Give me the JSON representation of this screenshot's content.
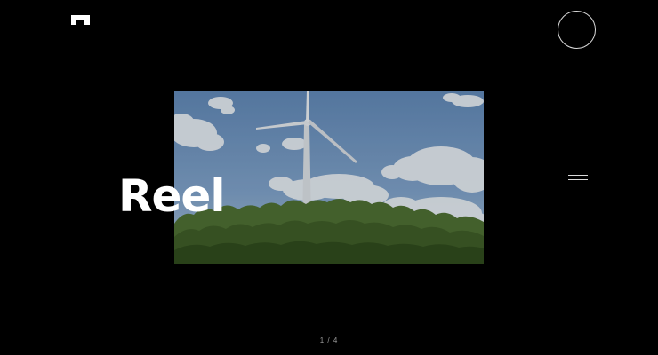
{
  "header": {
    "logo_icon": "logo-mark-icon",
    "circle_button_icon": "circle-outline-icon"
  },
  "hero": {
    "title": "Reel",
    "media_description_icon": "wind-turbine-video-thumbnail"
  },
  "menu": {
    "icon": "hamburger-menu-icon"
  },
  "pager": {
    "current": "1",
    "separator": "/",
    "total": "4"
  },
  "colors": {
    "background": "#000000",
    "text": "#ffffff",
    "pager_text": "#9a9a9a"
  }
}
